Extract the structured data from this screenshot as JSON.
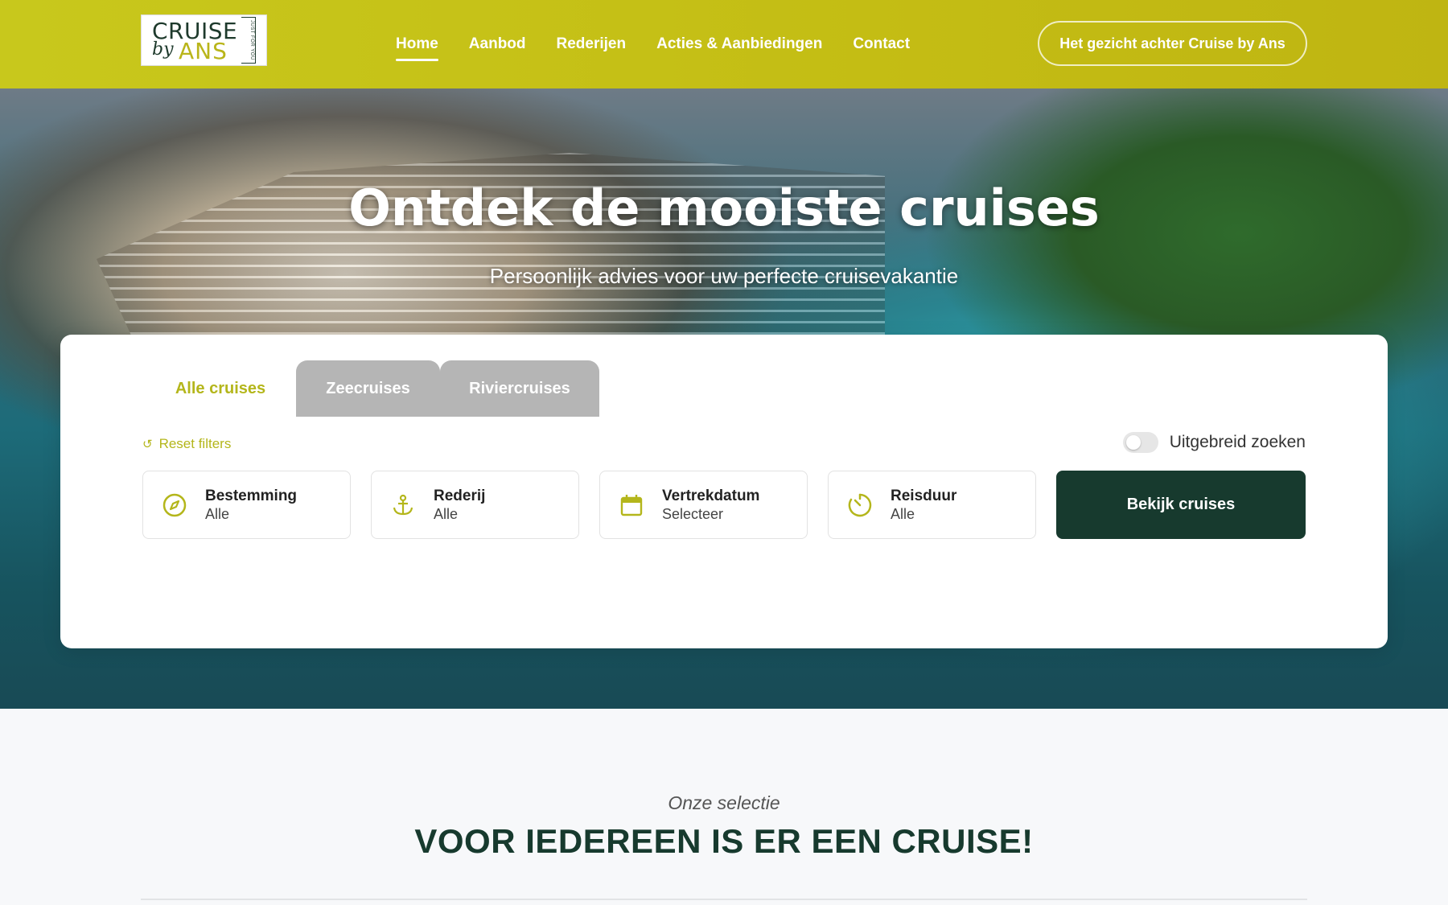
{
  "logo": {
    "line1": "CRUISE",
    "line2_by": "by",
    "line2_name": "ANS",
    "tagline": "JUST FOR YOU"
  },
  "nav": {
    "items": [
      {
        "label": "Home",
        "active": true
      },
      {
        "label": "Aanbod"
      },
      {
        "label": "Rederijen"
      },
      {
        "label": "Acties & Aanbiedingen"
      },
      {
        "label": "Contact"
      }
    ],
    "cta_label": "Het gezicht achter Cruise by Ans"
  },
  "hero": {
    "title": "Ontdek de mooiste cruises",
    "subtitle": "Persoonlijk advies voor uw perfecte cruisevakantie"
  },
  "search": {
    "tabs": [
      {
        "label": "Alle cruises",
        "active": true
      },
      {
        "label": "Zeecruises"
      },
      {
        "label": "Riviercruises"
      }
    ],
    "reset_label": "Reset filters",
    "advanced_label": "Uitgebreid zoeken",
    "advanced_enabled": false,
    "filters": [
      {
        "icon": "compass-icon",
        "label": "Bestemming",
        "value": "Alle"
      },
      {
        "icon": "anchor-icon",
        "label": "Rederij",
        "value": "Alle"
      },
      {
        "icon": "calendar-icon",
        "label": "Vertrekdatum",
        "value": "Selecteer"
      },
      {
        "icon": "timer-icon",
        "label": "Reisduur",
        "value": "Alle"
      }
    ],
    "submit_label": "Bekijk cruises"
  },
  "section": {
    "kicker": "Onze selectie",
    "headline": "VOOR IEDEREEN IS ER EEN CRUISE!"
  },
  "colors": {
    "header": "#c4bd14",
    "accent": "#b4b61b",
    "dark_green": "#173a2e",
    "tab_inactive": "#b5b5b5"
  }
}
